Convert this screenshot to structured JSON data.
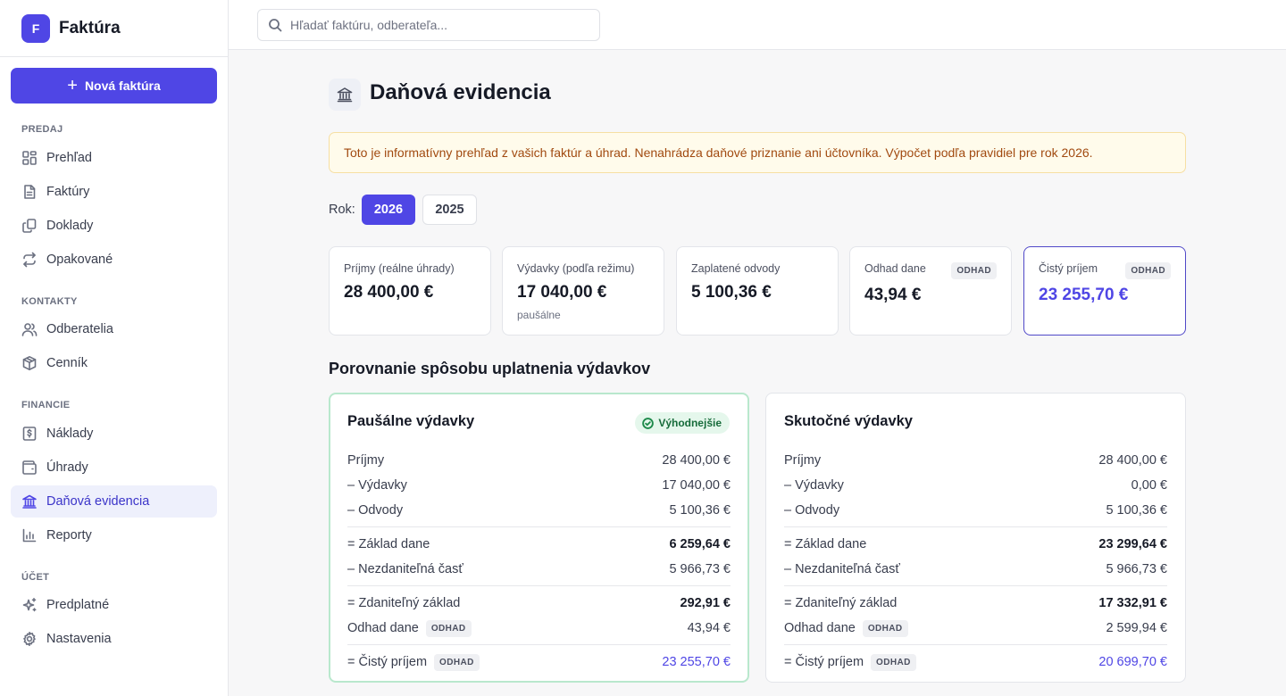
{
  "brand": {
    "logo_letter": "F",
    "name": "Faktúra"
  },
  "sidebar": {
    "new_button": "Nová faktúra",
    "sections": [
      {
        "title": "PREDAJ",
        "items": [
          {
            "label": "Prehľad",
            "icon": "dashboard-icon"
          },
          {
            "label": "Faktúry",
            "icon": "document-icon"
          },
          {
            "label": "Doklady",
            "icon": "copy-icon"
          },
          {
            "label": "Opakované",
            "icon": "repeat-icon"
          }
        ]
      },
      {
        "title": "KONTAKTY",
        "items": [
          {
            "label": "Odberatelia",
            "icon": "users-icon"
          },
          {
            "label": "Cenník",
            "icon": "box-icon"
          }
        ]
      },
      {
        "title": "FINANCIE",
        "items": [
          {
            "label": "Náklady",
            "icon": "receipt-icon"
          },
          {
            "label": "Úhrady",
            "icon": "wallet-icon"
          },
          {
            "label": "Daňová evidencia",
            "icon": "bank-icon",
            "active": true
          },
          {
            "label": "Reporty",
            "icon": "bar-chart-icon"
          }
        ]
      },
      {
        "title": "ÚČET",
        "items": [
          {
            "label": "Predplatné",
            "icon": "sparkles-icon"
          },
          {
            "label": "Nastavenia",
            "icon": "gear-icon"
          }
        ]
      }
    ]
  },
  "search": {
    "placeholder": "Hľadať faktúru, odberateľa..."
  },
  "page": {
    "title": "Daňová evidencia",
    "notice": "Toto je informatívny prehľad z vašich faktúr a úhrad. Nenahrádza daňové priznanie ani účtovníka. Výpočet podľa pravidiel pre rok 2026.",
    "year_label": "Rok:",
    "years": [
      "2026",
      "2025"
    ],
    "selected_year": "2026"
  },
  "stats": [
    {
      "label": "Príjmy (reálne úhrady)",
      "value": "28 400,00 €"
    },
    {
      "label": "Výdavky (podľa režimu)",
      "value": "17 040,00 €",
      "sub": "paušálne"
    },
    {
      "label": "Zaplatené odvody",
      "value": "5 100,36 €"
    },
    {
      "label": "Odhad dane",
      "value": "43,94 €",
      "badge": "ODHAD"
    },
    {
      "label": "Čistý príjem",
      "value": "23 255,70 €",
      "badge": "ODHAD"
    }
  ],
  "comparison": {
    "title": "Porovnanie spôsobu uplatnenia výdavkov",
    "best_label": "Výhodnejšie",
    "cards": [
      {
        "title": "Paušálne výdavky",
        "rows": {
          "income": {
            "label": "Príjmy",
            "value": "28 400,00 €"
          },
          "expenses": {
            "label": "–  Výdavky",
            "value": "17 040,00 €"
          },
          "levies": {
            "label": "–  Odvody",
            "value": "5 100,36 €"
          },
          "tax_base": {
            "label": "=  Základ dane",
            "value": "6 259,64 €"
          },
          "non_taxable": {
            "label": "–  Nezdaniteľná časť",
            "value": "5 966,73 €"
          },
          "taxable_base": {
            "label": "=  Zdaniteľný základ",
            "value": "292,91 €"
          },
          "tax_estimate": {
            "label": "Odhad dane",
            "value": "43,94 €",
            "badge": "ODHAD"
          },
          "net_income": {
            "label": "=  Čistý príjem",
            "value": "23 255,70 €",
            "badge": "ODHAD"
          }
        }
      },
      {
        "title": "Skutočné výdavky",
        "rows": {
          "income": {
            "label": "Príjmy",
            "value": "28 400,00 €"
          },
          "expenses": {
            "label": "–  Výdavky",
            "value": "0,00 €"
          },
          "levies": {
            "label": "–  Odvody",
            "value": "5 100,36 €"
          },
          "tax_base": {
            "label": "=  Základ dane",
            "value": "23 299,64 €"
          },
          "non_taxable": {
            "label": "–  Nezdaniteľná časť",
            "value": "5 966,73 €"
          },
          "taxable_base": {
            "label": "=  Zdaniteľný základ",
            "value": "17 332,91 €"
          },
          "tax_estimate": {
            "label": "Odhad dane",
            "value": "2 599,94 €",
            "badge": "ODHAD"
          },
          "net_income": {
            "label": "=  Čistý príjem",
            "value": "20 699,70 €",
            "badge": "ODHAD"
          }
        }
      }
    ]
  },
  "colors": {
    "accent": "#4f46e5",
    "success": "#1d8a4a",
    "warning_text": "#a14a10"
  }
}
